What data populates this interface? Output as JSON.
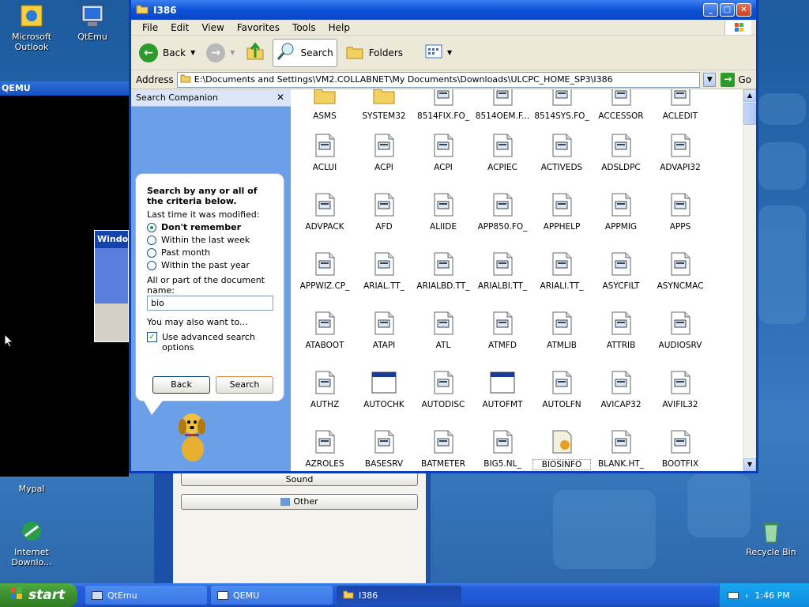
{
  "desktop": {
    "icons": [
      {
        "label": "Microsoft Outlook",
        "icon": "outlook-icon"
      },
      {
        "label": "QtEmu",
        "icon": "qtemu-icon"
      },
      {
        "label": "Mypal",
        "icon": "mypal-icon"
      },
      {
        "label": "Internet Downlo...",
        "icon": "internet-download-icon"
      },
      {
        "label": "Recycle Bin",
        "icon": "recycle-bin-icon"
      }
    ]
  },
  "qemu_window": {
    "title": "QEMU",
    "inner_title": "Windo"
  },
  "back_window": {
    "buttons": [
      "Sound",
      "Other"
    ]
  },
  "explorer": {
    "title": "I386",
    "menu": [
      "File",
      "Edit",
      "View",
      "Favorites",
      "Tools",
      "Help"
    ],
    "toolbar": {
      "back": "Back",
      "search": "Search",
      "folders": "Folders"
    },
    "address_label": "Address",
    "address": "E:\\Documents and Settings\\VM2.COLLABNET\\My Documents\\Downloads\\ULCPC_HOME_SP3\\I386",
    "go": "Go",
    "search_companion": {
      "title": "Search Companion",
      "heading": "Search by any or all of the criteria below.",
      "modified_label": "Last time it was modified:",
      "options": [
        "Don't remember",
        "Within the last week",
        "Past month",
        "Within the past year"
      ],
      "selected": "Don't remember",
      "name_label": "All or part of the document name:",
      "name_value": "bio",
      "also": "You may also want to...",
      "advanced": "Use advanced search options",
      "back_btn": "Back",
      "search_btn": "Search"
    },
    "files": [
      "ASMS",
      "SYSTEM32",
      "8514FIX.FO_",
      "8514OEM.F...",
      "8514SYS.FO_",
      "ACCESSOR",
      "ACLEDIT",
      "ACLUI",
      "ACPI",
      "ACPI",
      "ACPIEC",
      "ACTIVEDS",
      "ADSLDPC",
      "ADVAPI32",
      "ADVPACK",
      "AFD",
      "ALIIDE",
      "APP850.FO_",
      "APPHELP",
      "APPMIG",
      "APPS",
      "APPWIZ.CP_",
      "ARIAL.TT_",
      "ARIALBD.TT_",
      "ARIALBI.TT_",
      "ARIALI.TT_",
      "ASYCFILT",
      "ASYNCMAC",
      "ATABOOT",
      "ATAPI",
      "ATL",
      "ATMFD",
      "ATMLIB",
      "ATTRIB",
      "AUDIOSRV",
      "AUTHZ",
      "AUTOCHK",
      "AUTODISC",
      "AUTOFMT",
      "AUTOLFN",
      "AVICAP32",
      "AVIFIL32",
      "AZROLES",
      "BASESRV",
      "BATMETER",
      "BIG5.NL_",
      "BIOSINFO",
      "BLANK.HT_",
      "BOOTFIX"
    ]
  },
  "taskbar": {
    "start": "start",
    "tasks": [
      "QtEmu",
      "QEMU",
      "I386"
    ],
    "clock": "1:46 PM"
  }
}
